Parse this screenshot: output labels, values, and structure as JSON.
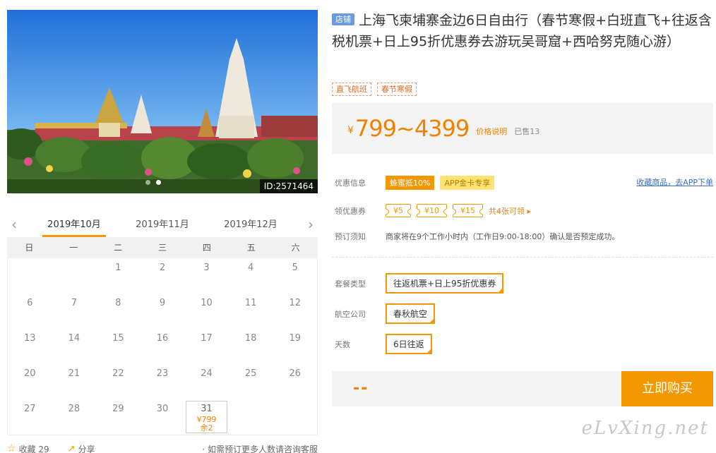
{
  "photo": {
    "id_label": "ID:2571464"
  },
  "calendar": {
    "months": [
      "2019年10月",
      "2019年11月",
      "2019年12月"
    ],
    "active_month": 0,
    "weekdays": [
      "日",
      "一",
      "二",
      "三",
      "四",
      "五",
      "六"
    ],
    "rows": [
      [
        "",
        "",
        "1",
        "2",
        "3",
        "4",
        "5"
      ],
      [
        "6",
        "7",
        "8",
        "9",
        "10",
        "11",
        "12"
      ],
      [
        "13",
        "14",
        "15",
        "16",
        "17",
        "18",
        "19"
      ],
      [
        "20",
        "21",
        "22",
        "23",
        "24",
        "25",
        "26"
      ],
      [
        "27",
        "28",
        "29",
        "30",
        "31",
        "",
        ""
      ]
    ],
    "selected": {
      "day": "31",
      "price": "¥799",
      "remain": "余2"
    }
  },
  "footer": {
    "fav": "收藏 29",
    "share": "分享",
    "note": "· 如需预订更多人数请咨询客服"
  },
  "product": {
    "shop_badge": "店铺",
    "title": "上海飞柬埔寨金边6日自由行（春节寒假+白班直飞+往返含税机票+日上95折优惠券去游玩吴哥窟+西哈努克随心游）",
    "tags": [
      "直飞航班",
      "春节寒假"
    ]
  },
  "price": {
    "currency": "¥",
    "range": "799~4399",
    "note": "价格说明",
    "sold": "已售13"
  },
  "promo": {
    "label": "优惠信息",
    "badge1": "蜂蜜抵10%",
    "badge2": "APP金卡专享",
    "fav_link": "收藏商品，去APP下单"
  },
  "coupons": {
    "label": "领优惠券",
    "items": [
      "¥5",
      "¥10",
      "¥15"
    ],
    "more": "共4张可领 ▸"
  },
  "notice": {
    "label": "预订须知",
    "text": "商家将在9个工作小时内（工作日9:00-18:00）确认是否预定成功。"
  },
  "options": [
    {
      "label": "套餐类型",
      "value": "往返机票+日上95折优惠券"
    },
    {
      "label": "航空公司",
      "value": "春秋航空"
    },
    {
      "label": "天数",
      "value": "6日往返"
    }
  ],
  "buy": {
    "qty": "--",
    "button": "立即购买"
  },
  "watermark": "eLvXing.net"
}
